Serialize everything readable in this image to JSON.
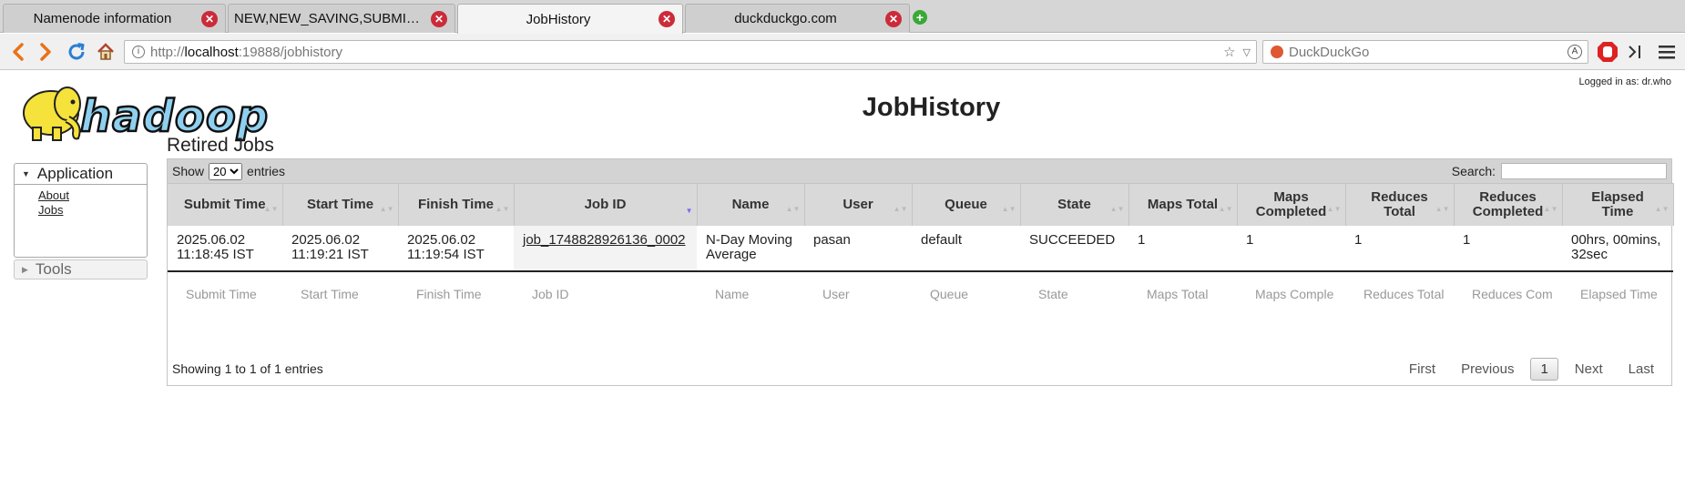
{
  "browser": {
    "tabs": [
      {
        "title": "Namenode information",
        "active": false
      },
      {
        "title": "NEW,NEW_SAVING,SUBMITTED,ACCEPTED,RUNNING Applications",
        "active": false
      },
      {
        "title": "JobHistory",
        "active": true
      },
      {
        "title": "duckduckgo.com",
        "active": false
      }
    ],
    "url_scheme": "http://",
    "url_host": "localhost",
    "url_rest": ":19888/jobhistory",
    "search_placeholder": "DuckDuckGo",
    "accent_colors": {
      "tab_close": "#cc2b3a",
      "new_tab": "#3aa835",
      "nav_arrow": "#e8731a",
      "reload": "#2a7fd4"
    }
  },
  "header": {
    "logged_in": "Logged in as: dr.who",
    "logo_text": "hadoop",
    "title": "JobHistory"
  },
  "sidebar": {
    "application_label": "Application",
    "links": [
      "About",
      "Jobs"
    ],
    "tools_label": "Tools"
  },
  "main": {
    "section_title": "Retired Jobs",
    "show_label": "Show",
    "entries_label": "entries",
    "page_size": "20",
    "search_label": "Search:",
    "columns": [
      "Submit Time",
      "Start Time",
      "Finish Time",
      "Job ID",
      "Name",
      "User",
      "Queue",
      "State",
      "Maps Total",
      "Maps Completed",
      "Reduces Total",
      "Reduces Completed",
      "Elapsed Time"
    ],
    "rows": [
      {
        "submit_time": "2025.06.02 11:18:45 IST",
        "start_time": "2025.06.02 11:19:21 IST",
        "finish_time": "2025.06.02 11:19:54 IST",
        "job_id": "job_1748828926136_0002",
        "name": "N-Day Moving Average",
        "user": "pasan",
        "queue": "default",
        "state": "SUCCEEDED",
        "maps_total": "1",
        "maps_completed": "1",
        "reduces_total": "1",
        "reduces_completed": "1",
        "elapsed_time": "00hrs, 00mins, 32sec"
      }
    ],
    "filter_placeholders": [
      "Submit Time",
      "Start Time",
      "Finish Time",
      "Job ID",
      "Name",
      "User",
      "Queue",
      "State",
      "Maps Total",
      "Maps Comple",
      "Reduces Total",
      "Reduces Com",
      "Elapsed Time"
    ],
    "info_text": "Showing 1 to 1 of 1 entries",
    "pager": {
      "first": "First",
      "previous": "Previous",
      "current": "1",
      "next": "Next",
      "last": "Last"
    }
  }
}
